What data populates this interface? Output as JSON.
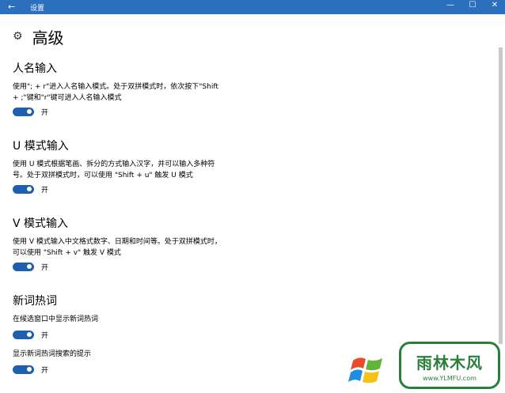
{
  "window": {
    "title": "设置",
    "back_icon": "←",
    "minimize": "—",
    "maximize": "☐",
    "close": "✕"
  },
  "page": {
    "title": "高级",
    "icon": "gear-icon"
  },
  "sections": [
    {
      "title": "人名输入",
      "desc_line1": "使用\"; + r\"进入人名输入模式。处于双拼模式时，依次按下\"Shift",
      "desc_line2": "+ ;\"键和\"r\"键可进入人名输入模式",
      "toggle_label": "开"
    },
    {
      "title": "U 模式输入",
      "desc_line1": "使用 U 模式根据笔画、拆分的方式输入汉字，并可以输入多种符",
      "desc_line2": "号。处于双拼模式时，可以使用 \"Shift + u\" 触发 U 模式",
      "toggle_label": "开"
    },
    {
      "title": "V 模式输入",
      "desc_line1": "使用 V 模式输入中文格式数字、日期和时间等。处于双拼模式时，",
      "desc_line2": "可以使用 \"Shift + v\" 触发 V 模式",
      "toggle_label": "开"
    },
    {
      "title": "新词热词",
      "option1": "在候选窗口中显示新词热词",
      "toggle1_label": "开",
      "option2": "显示新词热词搜索的提示",
      "toggle2_label": "开"
    }
  ],
  "watermark": {
    "text": "雨林木风",
    "url": "www.YLMFU.com"
  },
  "colors": {
    "titlebar": "#2b6fbd",
    "toggle_on": "#1f5fb0",
    "watermark": "#2a7f3a"
  }
}
